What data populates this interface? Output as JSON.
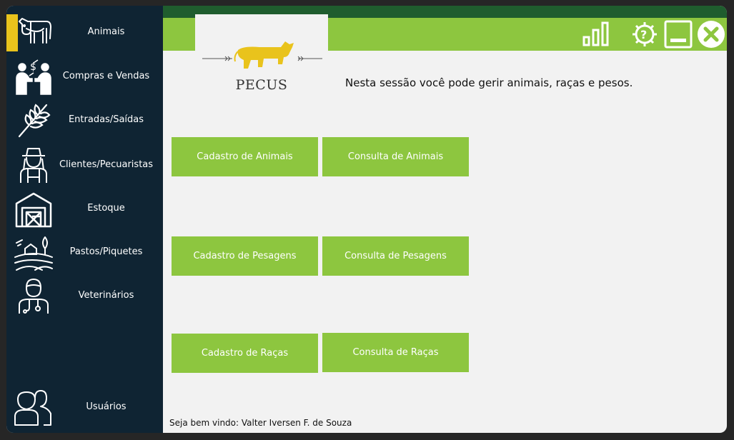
{
  "sidebar": {
    "items": [
      {
        "label": "Animais",
        "icon": "cow-icon",
        "active": true
      },
      {
        "label": "Compras e Vendas",
        "icon": "people-trade-icon"
      },
      {
        "label": "Entradas/Saídas",
        "icon": "wheat-icon"
      },
      {
        "label": "Clientes/Pecuaristas",
        "icon": "farmer-icon"
      },
      {
        "label": "Estoque",
        "icon": "barn-icon"
      },
      {
        "label": "Pastos/Piquetes",
        "icon": "field-icon"
      },
      {
        "label": "Veterinários",
        "icon": "doctor-icon"
      }
    ],
    "users": {
      "label": "Usuários",
      "icon": "users-icon"
    }
  },
  "logo": {
    "text": "PECUS"
  },
  "header": {
    "message": "Nesta sessão você pode gerir animais, raças e pesos."
  },
  "buttons": {
    "cadastro_animais": "Cadastro de Animais",
    "consulta_animais": "Consulta de Animais",
    "cadastro_pesagens": "Cadastro de Pesagens",
    "consulta_pesagens": "Consulta de Pesagens",
    "cadastro_racas": "Cadastro de Raças",
    "consulta_racas": "Consulta de Raças"
  },
  "footer": {
    "welcome": "Seja bem vindo: Valter Iversen F. de Souza"
  },
  "colors": {
    "sidebar_bg": "#0f2433",
    "accent_yellow": "#e9c31c",
    "primary_green": "#8dc63f",
    "dark_green": "#1f5d2e",
    "content_bg": "#f2f2f2"
  }
}
